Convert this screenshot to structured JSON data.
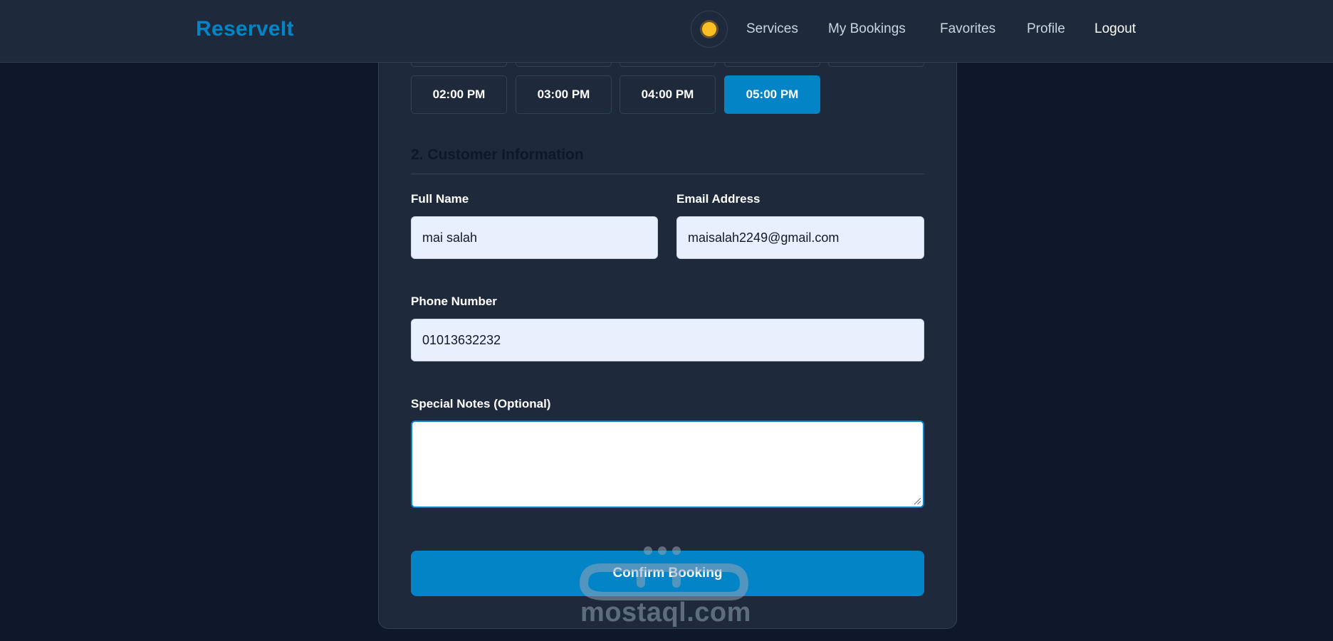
{
  "header": {
    "logo": "ReserveIt",
    "nav": {
      "services": "Services",
      "my_bookings": "My Bookings",
      "favorites": "Favorites",
      "profile": "Profile",
      "logout": "Logout"
    }
  },
  "time_slots": {
    "row2": [
      "02:00 PM",
      "03:00 PM",
      "04:00 PM",
      "05:00 PM"
    ],
    "selected": "05:00 PM"
  },
  "customer_info": {
    "title": "2. Customer Information",
    "full_name_label": "Full Name",
    "full_name_value": "mai salah",
    "email_label": "Email Address",
    "email_value": "maisalah2249@gmail.com",
    "phone_label": "Phone Number",
    "phone_value": "01013632232",
    "notes_label": "Special Notes (Optional)",
    "notes_value": ""
  },
  "confirm_label": "Confirm Booking",
  "watermark": {
    "text": "mostaql.com"
  },
  "colors": {
    "accent": "#0284c7",
    "background": "#0f172a",
    "card": "#1e293b"
  }
}
